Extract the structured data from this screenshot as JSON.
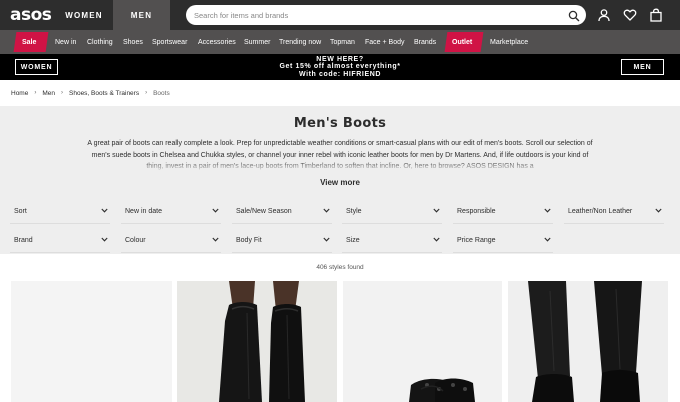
{
  "header": {
    "logo": "asos",
    "tabs": [
      "WOMEN",
      "MEN"
    ],
    "active_tab": "MEN",
    "search_placeholder": "Search for items and brands",
    "icons": [
      "search-icon",
      "account-icon",
      "wishlist-icon",
      "bag-icon"
    ]
  },
  "nav": {
    "items": [
      "Sale",
      "New in",
      "Clothing",
      "Shoes",
      "Sportswear",
      "Accessories",
      "Summer",
      "Trending now",
      "Topman",
      "Face + Body",
      "Brands",
      "Outlet",
      "Marketplace"
    ],
    "highlight_color": "#d01345"
  },
  "promo": {
    "women_button": "WOMEN",
    "men_button": "MEN",
    "line1": "NEW HERE?",
    "line2": "Get 15% off almost everything*",
    "line3": "With code: HIFRIEND"
  },
  "breadcrumb": [
    "Home",
    "Men",
    "Shoes, Boots & Trainers",
    "Boots"
  ],
  "intro": {
    "title": "Men's Boots",
    "description": "A great pair of boots can really complete a look. Prep for unpredictable weather conditions or smart-casual plans with our edit of men's boots. Scroll our selection of men's suede boots in Chelsea and Chukka styles, or channel your inner rebel with iconic leather boots for men by Dr Martens. And, if life outdoors is your kind of thing, invest in a pair of men's lace-up boots from Timberland to soften that incline. Or, here to browse? ASOS DESIGN has a",
    "view_more": "View more"
  },
  "filters": {
    "row1": [
      "Sort",
      "New in date",
      "Sale/New Season",
      "Style",
      "Responsible",
      "Leather/Non Leather"
    ],
    "row2": [
      "Brand",
      "Colour",
      "Body Fit",
      "Size",
      "Price Range"
    ]
  },
  "results": {
    "count_text": "406 styles found"
  },
  "colors": {
    "header_bg": "#2d2d2d",
    "nav_bg": "#525050",
    "accent": "#d01345",
    "panel_bg": "#eeeeee"
  }
}
